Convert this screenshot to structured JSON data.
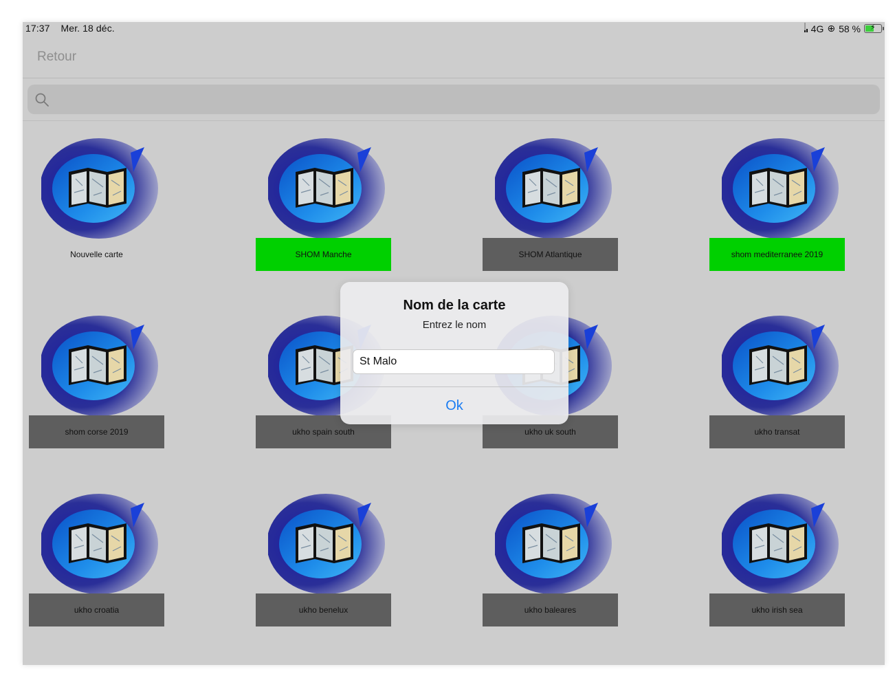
{
  "status_bar": {
    "time": "17:37",
    "date": "Mer. 18 déc.",
    "network": "4G",
    "battery": "58 %",
    "battery_level": 0.58
  },
  "nav": {
    "back_label": "Retour"
  },
  "search": {
    "placeholder": ""
  },
  "charts": [
    {
      "label": "Nouvelle carte",
      "state": "none"
    },
    {
      "label": "SHOM Manche",
      "state": "green"
    },
    {
      "label": "SHOM Atlantique",
      "state": "gray"
    },
    {
      "label": "shom mediterranee 2019",
      "state": "green"
    },
    {
      "label": "shom corse 2019",
      "state": "gray"
    },
    {
      "label": "ukho spain south",
      "state": "gray"
    },
    {
      "label": "ukho uk south",
      "state": "gray"
    },
    {
      "label": "ukho transat",
      "state": "gray"
    },
    {
      "label": "ukho croatia",
      "state": "gray"
    },
    {
      "label": "ukho benelux",
      "state": "gray"
    },
    {
      "label": "ukho baleares",
      "state": "gray"
    },
    {
      "label": "ukho irish sea",
      "state": "gray"
    }
  ],
  "alert": {
    "title": "Nom de la carte",
    "message": "Entrez le nom",
    "input_value": "St Malo",
    "ok_label": "Ok"
  },
  "colors": {
    "green_label": "#00d000",
    "gray_label": "#5e5e5e",
    "ok_blue": "#1a7cf2",
    "background": "#cdcdcd"
  }
}
